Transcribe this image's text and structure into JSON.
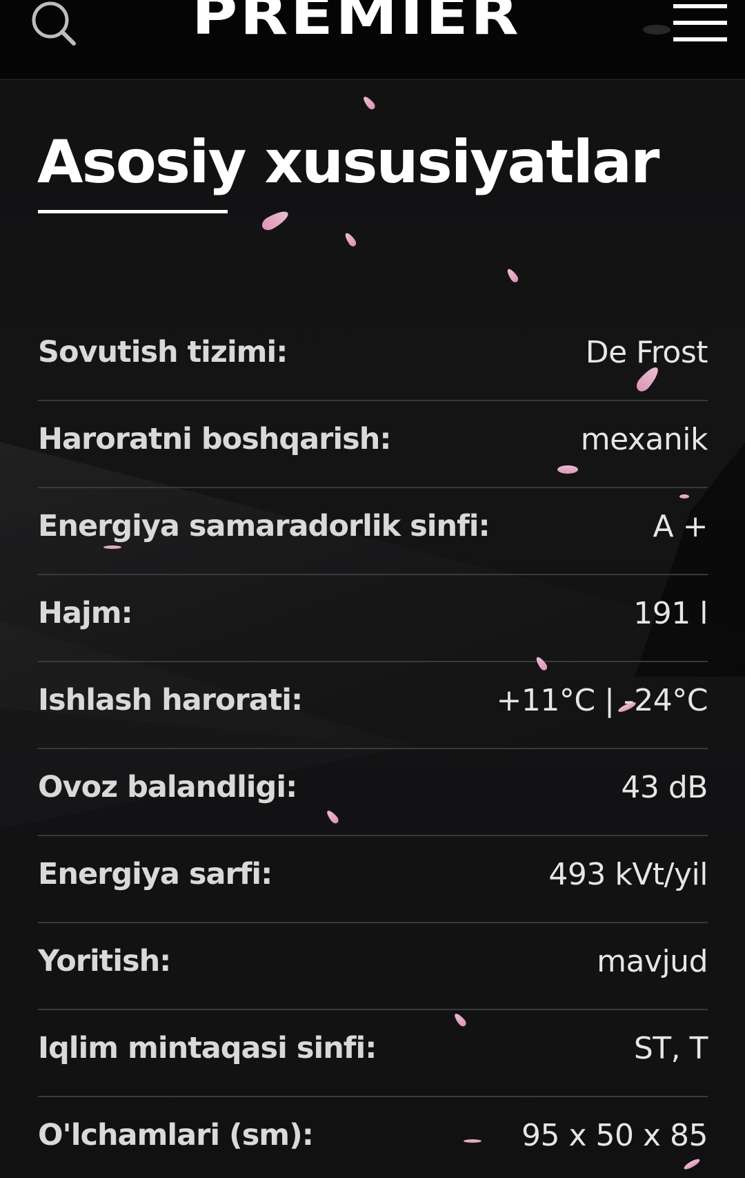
{
  "header": {
    "brand": "PREMIER",
    "search_icon": "search-icon",
    "menu_icon": "hamburger-menu-icon"
  },
  "section": {
    "title": "Asosiy xususiyatlar"
  },
  "specs": [
    {
      "label": "Sovutish tizimi:",
      "value": "De Frost"
    },
    {
      "label": "Haroratni boshqarish:",
      "value": "mexanik"
    },
    {
      "label": "Energiya samaradorlik sinfi:",
      "value": "A +"
    },
    {
      "label": "Hajm:",
      "value": "191 l"
    },
    {
      "label": "Ishlash harorati:",
      "value": "+11°C | -24°C"
    },
    {
      "label": "Ovoz balandligi:",
      "value": "43 dB"
    },
    {
      "label": "Energiya sarfi:",
      "value": "493 kVt/yil"
    },
    {
      "label": "Yoritish:",
      "value": "mavjud"
    },
    {
      "label": "Iqlim mintaqasi sinfi:",
      "value": "ST, T"
    },
    {
      "label": "O'lchamlari (sm):",
      "value": "95 x 50 x 85"
    }
  ],
  "colors": {
    "background": "#111112",
    "header_background": "#050505",
    "petal": "#f0b6d0",
    "divider": "#3a3a3c"
  }
}
